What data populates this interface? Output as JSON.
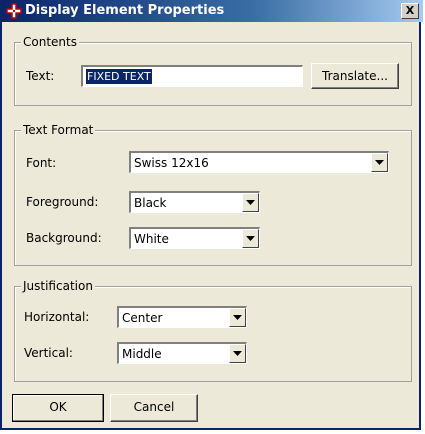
{
  "window": {
    "title": "Display Element Properties",
    "close_label": "X",
    "icon": "red-cross-app-icon"
  },
  "contents": {
    "legend": "Contents",
    "text_label": "Text:",
    "text_value": "FIXED TEXT",
    "translate_button": "Translate..."
  },
  "text_format": {
    "legend": "Text Format",
    "font_label": "Font:",
    "font_value": "Swiss 12x16",
    "foreground_label": "Foreground:",
    "foreground_value": "Black",
    "background_label": "Background:",
    "background_value": "White"
  },
  "justification": {
    "legend": "Justification",
    "horizontal_label": "Horizontal:",
    "horizontal_value": "Center",
    "vertical_label": "Vertical:",
    "vertical_value": "Middle"
  },
  "footer": {
    "ok_button": "OK",
    "cancel_button": "Cancel"
  },
  "colors": {
    "titlebar": "#0a246a",
    "dialog_face": "#ece9d8",
    "selection": "#0a246a"
  }
}
